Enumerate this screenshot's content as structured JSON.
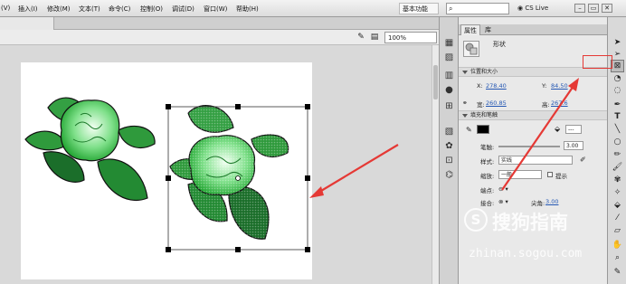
{
  "menubar": {
    "items": [
      "(V)",
      "插入(I)",
      "修改(M)",
      "文本(T)",
      "命令(C)",
      "控制(O)",
      "调试(D)",
      "窗口(W)",
      "帮助(H)"
    ],
    "workspace": "基本功能",
    "search_icon": "search-icon",
    "cs_live": "CS Live",
    "window_buttons": [
      "–",
      "▭",
      "✕"
    ]
  },
  "editbar": {
    "zoom": "100%"
  },
  "panel": {
    "tabs": [
      "属性",
      "库"
    ],
    "shape_label": "形状",
    "section_position": "位置和大小",
    "x_label": "X:",
    "x_value": "278.40",
    "y_label": "Y:",
    "y_value": "84.50",
    "w_label": "宽:",
    "w_value": "260.85",
    "h_label": "高:",
    "h_value": "267.6",
    "section_fill": "填充和笔触",
    "stroke_width_label": "笔触:",
    "stroke_width_value": "3.00",
    "style_label": "样式:",
    "style_value": "实线",
    "scale_label": "缩放:",
    "scale_value": "一般",
    "hint_label": "提示",
    "cap_label": "端点:",
    "join_label": "接合:",
    "miter_label": "尖角:",
    "miter_value": "3.00",
    "stroke_color": "#000000",
    "fill_field_value": "---"
  },
  "watermark": {
    "name": "搜狗指南",
    "url": "zhinan.sogou.com"
  },
  "colors": {
    "annotation_red": "#e53935",
    "leaf_green": "#2e9e3a",
    "leaf_dark": "#1e6b2a",
    "flower_green": "#5fd36a"
  }
}
